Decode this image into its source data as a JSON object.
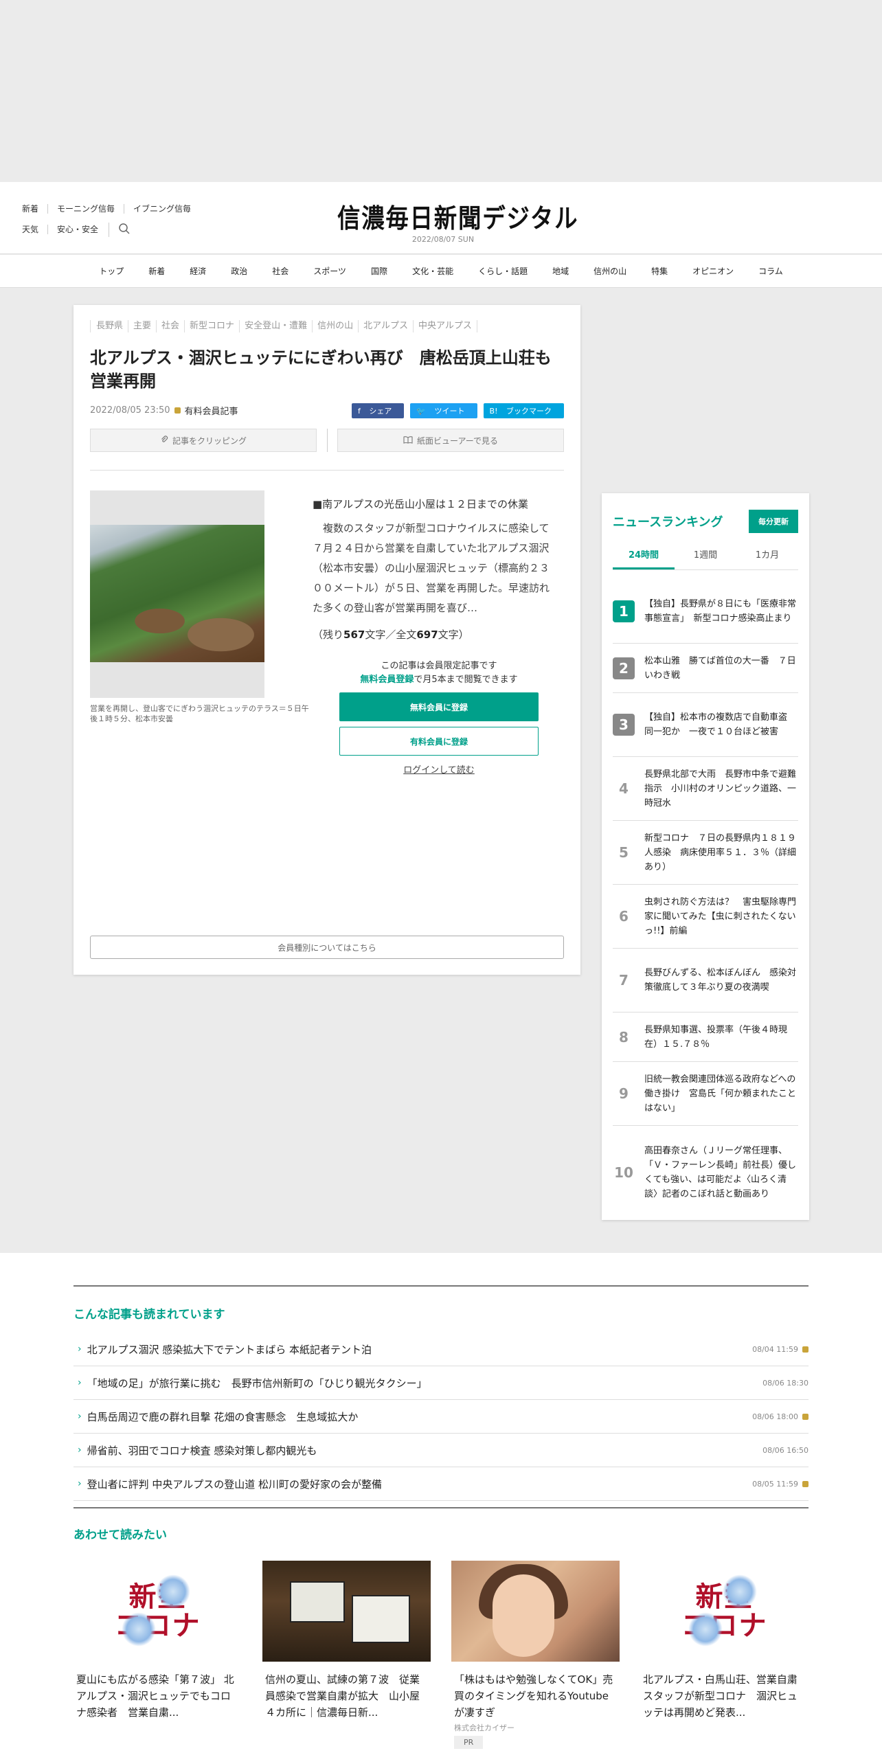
{
  "header": {
    "links_row1": [
      "新着",
      "モーニング信毎",
      "イブニング信毎"
    ],
    "links_row2": [
      "天気",
      "安心・安全"
    ],
    "logo": "信濃毎日新聞デジタル",
    "date": "2022/08/07 SUN"
  },
  "nav": [
    "トップ",
    "新着",
    "経済",
    "政治",
    "社会",
    "スポーツ",
    "国際",
    "文化・芸能",
    "くらし・話題",
    "地域",
    "信州の山",
    "特集",
    "オピニオン",
    "コラム"
  ],
  "article": {
    "tags": [
      "長野県",
      "主要",
      "社会",
      "新型コロナ",
      "安全登山・遭難",
      "信州の山",
      "北アルプス",
      "中央アルプス"
    ],
    "headline": "北アルプス・涸沢ヒュッテににぎわい再び　唐松岳頂上山荘も営業再開",
    "datetime": "2022/08/05 23:50",
    "paid_label": "有料会員記事",
    "share": {
      "facebook": "シェア",
      "twitter": "ツイート",
      "hatena": "ブックマーク"
    },
    "clip_label": "記事をクリッピング",
    "viewer_label": "紙面ビューアーで見る",
    "photo_caption": "営業を再開し、登山客でにぎわう涸沢ヒュッテのテラス＝５日午後１時５分、松本市安曇",
    "lead": "■南アルプスの光岳山小屋は１２日までの休業",
    "body": "　複数のスタッフが新型コロナウイルスに感染して７月２４日から営業を自粛していた北アルプス涸沢（松本市安曇）の山小屋涸沢ヒュッテ（標高約２３００メートル）が５日、営業を再開した。早速訪れた多くの登山客が営業再開を喜び…",
    "remain_prefix": "（残り",
    "remain_count": "567",
    "remain_mid": "文字／全文",
    "total_count": "697",
    "remain_suffix": "文字）",
    "members_note": "この記事は会員限定記事です",
    "members_free_link": "無料会員登録",
    "members_note2": "で月5本まで閲覧できます",
    "free_button": "無料会員に登録",
    "paid_button": "有料会員に登録",
    "login_link": "ログインして読む",
    "member_types": "会員種別についてはこちら"
  },
  "ranking": {
    "title": "ニュースランキング",
    "update": "毎分更新",
    "tabs": [
      "24時間",
      "1週間",
      "1カ月"
    ],
    "items": [
      {
        "rank": "1",
        "text": "【独自】長野県が８日にも「医療非常事態宣言」　新型コロナ感染高止まり"
      },
      {
        "rank": "2",
        "text": "松本山雅　勝てば首位の大一番　７日いわき戦"
      },
      {
        "rank": "3",
        "text": "【独自】松本市の複数店で自動車盗　同一犯か　一夜で１０台ほど被害"
      },
      {
        "rank": "4",
        "text": "長野県北部で大雨　長野市中条で避難指示　小川村のオリンピック道路、一時冠水"
      },
      {
        "rank": "5",
        "text": "新型コロナ　７日の長野県内１８１９人感染　病床使用率５１．３％（詳細あり）"
      },
      {
        "rank": "6",
        "text": "虫刺され防ぐ方法は？　害虫駆除専門家に聞いてみた【虫に刺されたくないっ!!】前編"
      },
      {
        "rank": "7",
        "text": "長野びんずる、松本ぼんぼん　感染対策徹底して３年ぶり夏の夜満喫"
      },
      {
        "rank": "8",
        "text": "長野県知事選、投票率（午後４時現在）１５.７８％"
      },
      {
        "rank": "9",
        "text": "旧統一教会関連団体巡る政府などへの働き掛け　宮島氏「何か頼まれたことはない」"
      },
      {
        "rank": "10",
        "text": "高田春奈さん（Ｊリーグ常任理事、「Ｖ・ファーレン長崎」前社長）優しくても強い、は可能だよ〈山ろく清談〉記者のこぼれ話と動画あり"
      }
    ]
  },
  "popular": {
    "title": "こんな記事も読まれています",
    "items": [
      {
        "text": "北アルプス涸沢 感染拡大下でテントまばら 本紙記者テント泊",
        "date": "08/04 11:59",
        "locked": true
      },
      {
        "text": "「地域の足」が旅行業に挑む　長野市信州新町の「ひじり観光タクシー」",
        "date": "08/06 18:30",
        "locked": false
      },
      {
        "text": "白馬岳周辺で鹿の群れ目撃 花畑の食害懸念　生息域拡大か",
        "date": "08/06 18:00",
        "locked": true
      },
      {
        "text": "帰省前、羽田でコロナ検査 感染対策し都内観光も",
        "date": "08/06 16:50",
        "locked": false
      },
      {
        "text": "登山者に評判 中央アルプスの登山道 松川町の愛好家の会が整備",
        "date": "08/05 11:59",
        "locked": true
      }
    ]
  },
  "recommend": {
    "title": "あわせて読みたい",
    "corona_line1": "新型",
    "corona_line2": "コロナ",
    "cards": [
      {
        "text": "夏山にも広がる感染「第７波」 北アルプス・涸沢ヒュッテでもコロナ感染者　営業自粛..."
      },
      {
        "text": "信州の夏山、試練の第７波　従業員感染で営業自粛が拡大　山小屋４カ所に｜信濃毎日新..."
      },
      {
        "text": "「株はもはや勉強しなくてOK」売買のタイミングを知れるYoutubeが凄すぎ",
        "sponsor": "株式会社カイザー",
        "pr": "PR"
      },
      {
        "text": "北アルプス・白馬山荘、営業自粛　スタッフが新型コロナ　涸沢ヒュッテは再開めど発表..."
      }
    ]
  },
  "colors": {
    "accent": "#00a08a",
    "lock": "#c9a43a",
    "facebook": "#3b5998",
    "twitter": "#1da1f2",
    "hatena": "#00a4de"
  },
  "icons": [
    "search-icon",
    "clip-icon",
    "book-icon",
    "lock-icon",
    "chevron-right-icon"
  ]
}
